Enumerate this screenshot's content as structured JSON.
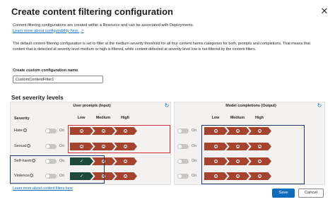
{
  "colors": {
    "accent": "#0f6cbd",
    "filter_on": "#a5432e",
    "filter_off": "#1e4a3b",
    "highlight_red": "#d13438",
    "highlight_navy": "#1f3a6e"
  },
  "dialog": {
    "title": "Create content filtering configuration",
    "close_icon": "close-icon"
  },
  "intro": {
    "text": "Content filtering configurations are created within a Resource and can be associated with Deployments.",
    "link": "Learn more about configurability here."
  },
  "description": "The default content filtering configuration is set to filter at the medium severity threshold for all four content harms categories for both, prompts and completions. That means that content that is detected at severity level medium or high is filtered, while content detected at severity level low is not filtered by the content filters.",
  "config_name": {
    "label": "Create custom configuration name",
    "value": "CustomContentFilter1"
  },
  "severity": {
    "title": "Set severity levels",
    "severity_header": "Severity",
    "prompts_header": "User prompts (Input)",
    "completions_header": "Model completions (Output)",
    "levels": [
      "Low",
      "Medium",
      "High"
    ],
    "refresh_icon": "refresh-icon",
    "toggle_label": "On",
    "categories": [
      {
        "name": "Hate",
        "prompt": [
          "filter",
          "filter",
          "filter"
        ],
        "completion": [
          "filter",
          "filter",
          "filter"
        ]
      },
      {
        "name": "Sexual",
        "prompt": [
          "filter",
          "filter",
          "filter"
        ],
        "completion": [
          "filter",
          "filter",
          "filter"
        ]
      },
      {
        "name": "Self-harm",
        "prompt": [
          "allow",
          "filter",
          "filter"
        ],
        "completion": [
          "filter",
          "filter",
          "filter"
        ]
      },
      {
        "name": "Violence",
        "prompt": [
          "allow",
          "filter",
          "filter"
        ],
        "completion": [
          "filter",
          "filter",
          "filter"
        ]
      }
    ]
  },
  "footer": {
    "link": "Learn more about content filters here",
    "save_label": "Save",
    "cancel_label": "Cancel"
  }
}
